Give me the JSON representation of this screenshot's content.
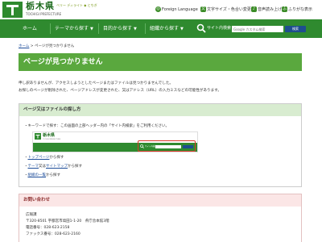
{
  "header": {
    "pref_name": "栃木県",
    "pref_sub": "TOCHIGI PREFECTURE",
    "slogan_line1": "ベリー ディライト ◆ とちぎ",
    "slogan_line2": "",
    "links": {
      "language": "Foreign Language",
      "text_size": "文字サイズ・色合い変更",
      "voice": "音声読み上げ",
      "furigana": "ふりがな表示"
    },
    "icons": {
      "language": "globe-icon",
      "text_size": "text-size-icon",
      "voice": "speaker-icon",
      "furigana": "furigana-icon"
    }
  },
  "nav": {
    "items": [
      {
        "label": "ホーム",
        "chevron": ""
      },
      {
        "label": "テーマから探す",
        "chevron": "▼"
      },
      {
        "label": "目的から探す",
        "chevron": "▼"
      },
      {
        "label": "組織から探す",
        "chevron": "▼"
      }
    ],
    "search_label": "サイト内検索",
    "search_placeholder": "Google カスタム検索",
    "search_button": "検索"
  },
  "breadcrumb": {
    "home": "ホーム",
    "sep": " > ",
    "current": "ページが見つかりません"
  },
  "page_title": "ページが見つかりません",
  "intro": {
    "line1": "申し訳ありませんが、アクセスしようとしたページまたはファイルは見つかりませんでした。",
    "line2": "お探しのページが削除された、ページアドレスが変更された、又はアドレス（URL）の入力ミスなどの可能性があります。"
  },
  "find_section": {
    "title": "ページ又はファイルの探し方",
    "bullet_keyword": "キーワードで探す：この画面の上部ヘッダー内の「サイト内検索」をご利用ください。",
    "mini_header": {
      "pref_name": "栃木県",
      "pref_sub": "TOCHIGI PREFECTURE",
      "search_label": "サイト内検索"
    },
    "link_top": {
      "link": "トップページ",
      "suffix": "から探す"
    },
    "link_theme": {
      "link1": "テーマ",
      "mid": "又は",
      "link2": "サイトマップ",
      "suffix": "から探す"
    },
    "link_org": {
      "link": "組織の一覧",
      "suffix": "から探す"
    }
  },
  "contact": {
    "title": "お問い合わせ",
    "dept": "広報課",
    "address": "〒320-8501 宇都宮市塙田1-1-20　県庁舎本館3階",
    "phone": "電話番号：028-623-2158",
    "fax": "ファックス番号：028-623-2160"
  },
  "colors": {
    "nav_green": "#2f8a2f",
    "title_green": "#5aa83e",
    "link_blue": "#1f4e9a",
    "search_blue": "#1e4e8e",
    "highlight_red": "#d83a2a"
  }
}
